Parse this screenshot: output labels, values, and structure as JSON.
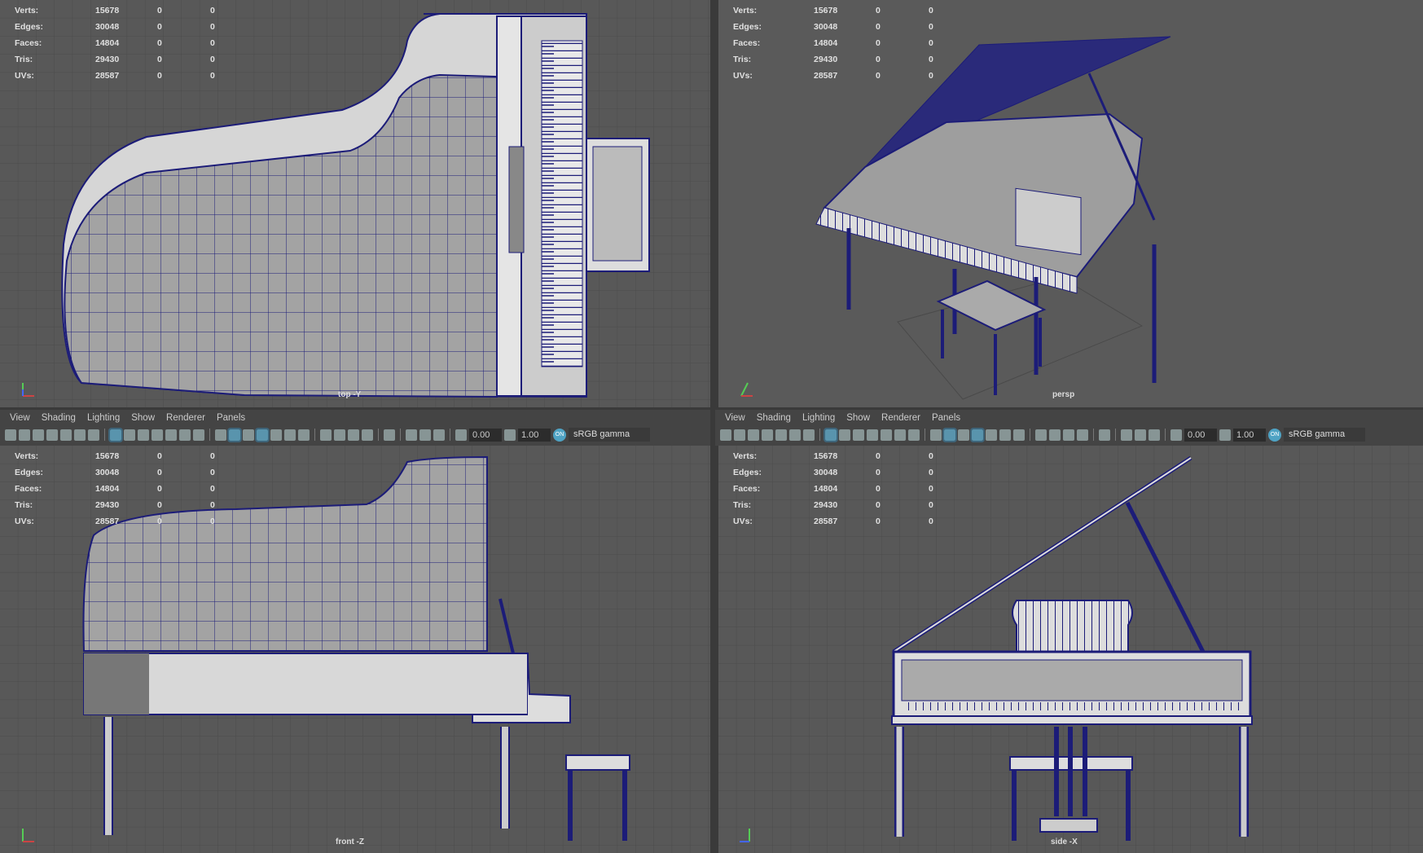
{
  "menu": [
    "View",
    "Shading",
    "Lighting",
    "Show",
    "Renderer",
    "Panels"
  ],
  "stats": [
    {
      "label": "Verts:",
      "value": "15678",
      "c1": "0",
      "c2": "0"
    },
    {
      "label": "Edges:",
      "value": "30048",
      "c1": "0",
      "c2": "0"
    },
    {
      "label": "Faces:",
      "value": "14804",
      "c1": "0",
      "c2": "0"
    },
    {
      "label": "Tris:",
      "value": "29430",
      "c1": "0",
      "c2": "0"
    },
    {
      "label": "UVs:",
      "value": "28587",
      "c1": "0",
      "c2": "0"
    }
  ],
  "viewports": {
    "top": "top -Y",
    "persp": "persp",
    "front": "front -Z",
    "side": "side -X"
  },
  "toolbar": {
    "exposure": "0.00",
    "gamma": "1.00",
    "colorspace": "sRGB gamma",
    "on_badge": "ON",
    "icons": [
      "camera-select-icon",
      "camera-lock-icon",
      "camera-attr-icon",
      "bookmark-icon",
      "image-plane-icon",
      "2d-pan-icon",
      "grease-pencil-icon",
      "|",
      "grid-icon",
      "film-gate-icon",
      "resolution-gate-icon",
      "gate-mask-icon",
      "field-chart-icon",
      "safe-action-icon",
      "safe-title-icon",
      "|",
      "wireframe-icon",
      "smooth-shade-icon",
      "default-material-icon",
      "wireframe-on-shaded-icon",
      "xray-icon",
      "use-all-lights-icon",
      "shadows-icon",
      "|",
      "screen-space-ao-icon",
      "motion-blur-icon",
      "multisample-aa-icon",
      "depth-of-field-icon",
      "|",
      "isolate-select-icon",
      "|",
      "xray-joints-icon",
      "xray-active-icon",
      "backface-icon",
      "|",
      "exposure-icon"
    ],
    "active": [
      "grid-icon",
      "smooth-shade-icon",
      "wireframe-on-shaded-icon"
    ]
  },
  "colors": {
    "wire": "#1c1c78",
    "mesh": "#a3a3a3",
    "bg": "#585858"
  }
}
